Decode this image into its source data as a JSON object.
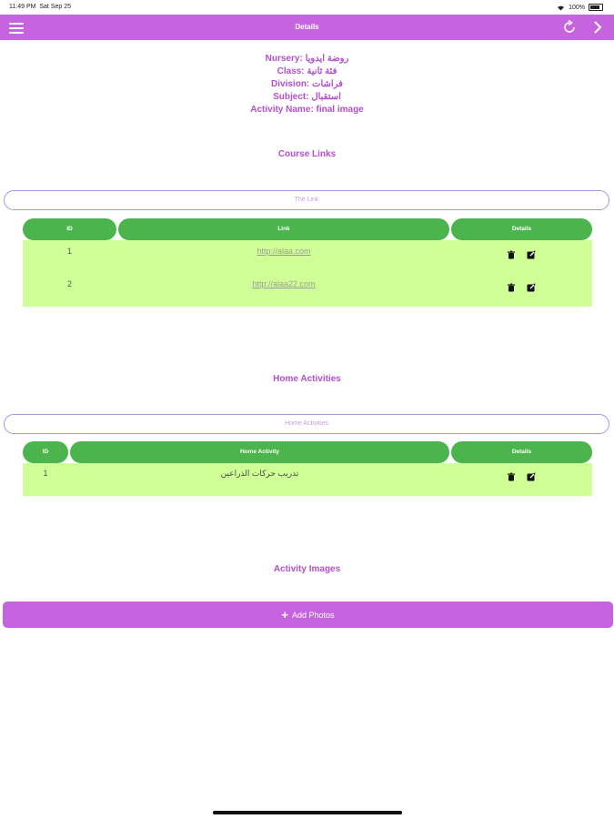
{
  "status": {
    "time": "11:49 PM",
    "date": "Sat Sep 25",
    "battery": "100%"
  },
  "nav": {
    "title": "Details"
  },
  "info": {
    "nursery": "Nursery: روضة ايدويا",
    "class": "Class: فئة ثانية",
    "division": "Division: فراشات",
    "subject": "Subject: استقبال",
    "activity": "Activity Name: final image"
  },
  "course_links": {
    "title": "Course Links",
    "search_placeholder": "The Link",
    "headers": {
      "id": "ID",
      "link": "Link",
      "details": "Details"
    },
    "rows": [
      {
        "id": "1",
        "link": "http://alaa.com"
      },
      {
        "id": "2",
        "link": "http://alaa22.com"
      }
    ]
  },
  "home_activities": {
    "title": "Home Activities",
    "search_placeholder": "Home Activities",
    "headers": {
      "id": "ID",
      "activity": "Home Activity",
      "details": "Details"
    },
    "rows": [
      {
        "id": "1",
        "activity": "تدريب حركات الذراعين"
      }
    ]
  },
  "images": {
    "title": "Activity Images",
    "add_label": "Add Photos"
  },
  "colors": {
    "primary": "#c663df",
    "header_green": "#4cb44c",
    "row_green": "#d0ff98",
    "label_purple": "#b44fd0"
  }
}
